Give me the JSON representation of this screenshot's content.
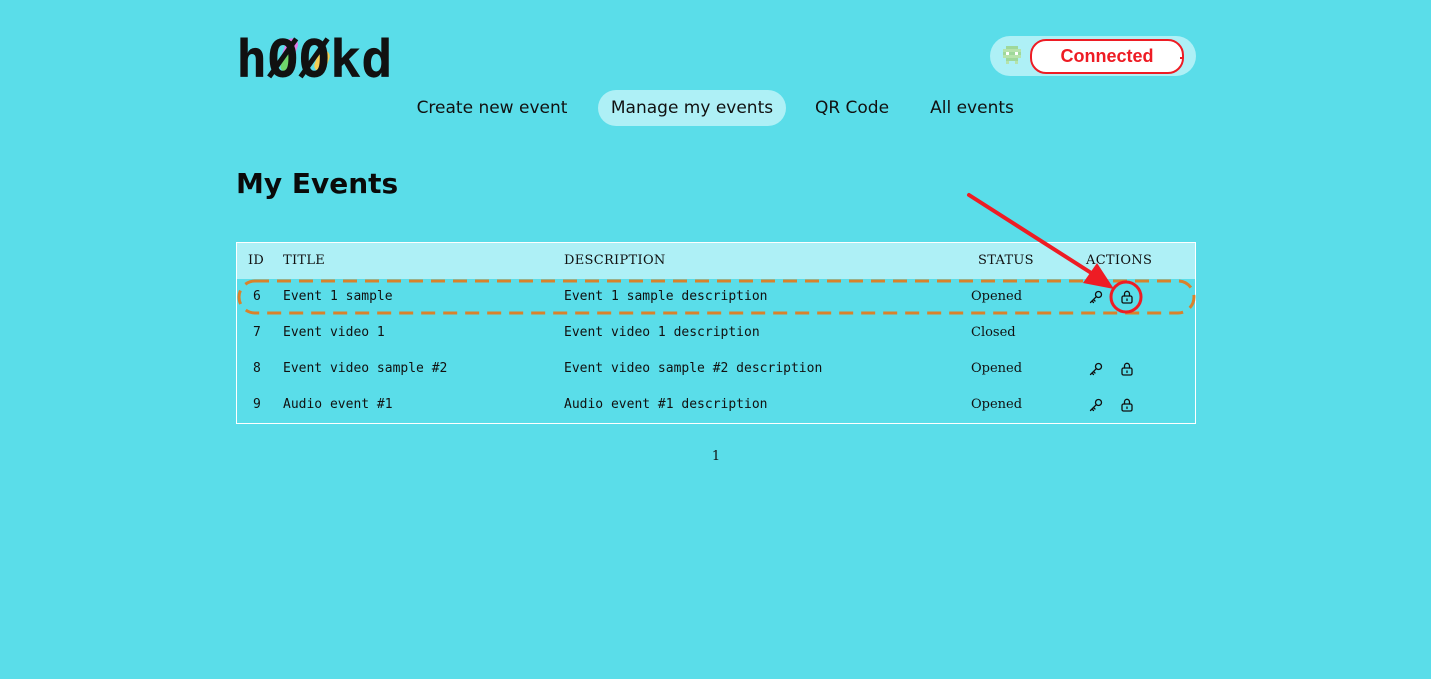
{
  "brand": {
    "logo_text": "hØØkd"
  },
  "wallet": {
    "status_label": "Connected",
    "avatar_icon": "pixel-avatar-icon"
  },
  "nav": {
    "items": [
      {
        "label": "Create new event"
      },
      {
        "label": "Manage my events",
        "active": true
      },
      {
        "label": "QR Code"
      },
      {
        "label": "All events"
      }
    ]
  },
  "page": {
    "title": "My Events"
  },
  "table": {
    "headers": {
      "id": "ID",
      "title": "TITLE",
      "description": "DESCRIPTION",
      "status": "STATUS",
      "actions": "ACTIONS"
    },
    "rows": [
      {
        "id": "6",
        "title": "Event 1 sample",
        "description": "Event 1 sample description",
        "status": "Opened",
        "actions": [
          "key-icon",
          "lock-icon"
        ]
      },
      {
        "id": "7",
        "title": "Event video 1",
        "description": "Event video 1 description",
        "status": "Closed",
        "actions": []
      },
      {
        "id": "8",
        "title": "Event video sample #2",
        "description": "Event video sample #2 description",
        "status": "Opened",
        "actions": [
          "key-icon",
          "lock-icon"
        ]
      },
      {
        "id": "9",
        "title": "Audio event #1",
        "description": "Audio event #1 description",
        "status": "Opened",
        "actions": [
          "key-icon",
          "lock-icon"
        ]
      }
    ]
  },
  "pagination": {
    "current_page": "1"
  },
  "colors": {
    "background": "#5adde9",
    "header_row": "#aef0f6",
    "connected_red": "#ee1c24",
    "annotation_orange": "#d9822b",
    "annotation_red": "#ee1c24"
  }
}
